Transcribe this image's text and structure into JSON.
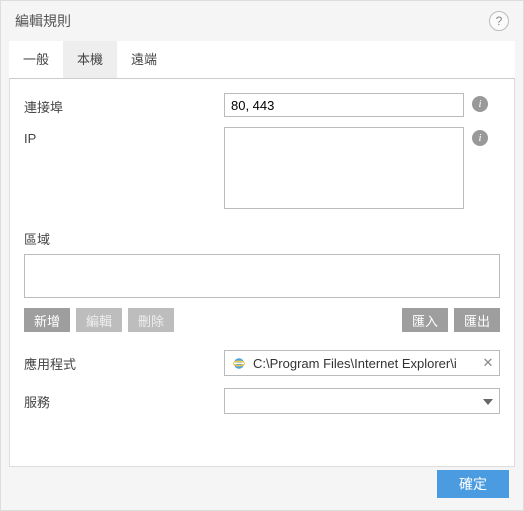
{
  "dialog": {
    "title": "編輯規則",
    "help_tooltip": "?"
  },
  "tabs": {
    "general": "一般",
    "local": "本機",
    "remote": "遠端",
    "active_index": 1
  },
  "fields": {
    "port_label": "連接埠",
    "port_value": "80, 443",
    "ip_label": "IP",
    "ip_value": "",
    "zone_label": "區域",
    "app_label": "應用程式",
    "app_value": "C:\\Program Files\\Internet Explorer\\i",
    "service_label": "服務",
    "service_value": ""
  },
  "buttons": {
    "add": "新增",
    "edit": "編輯",
    "delete": "刪除",
    "import": "匯入",
    "export": "匯出",
    "ok": "確定"
  }
}
